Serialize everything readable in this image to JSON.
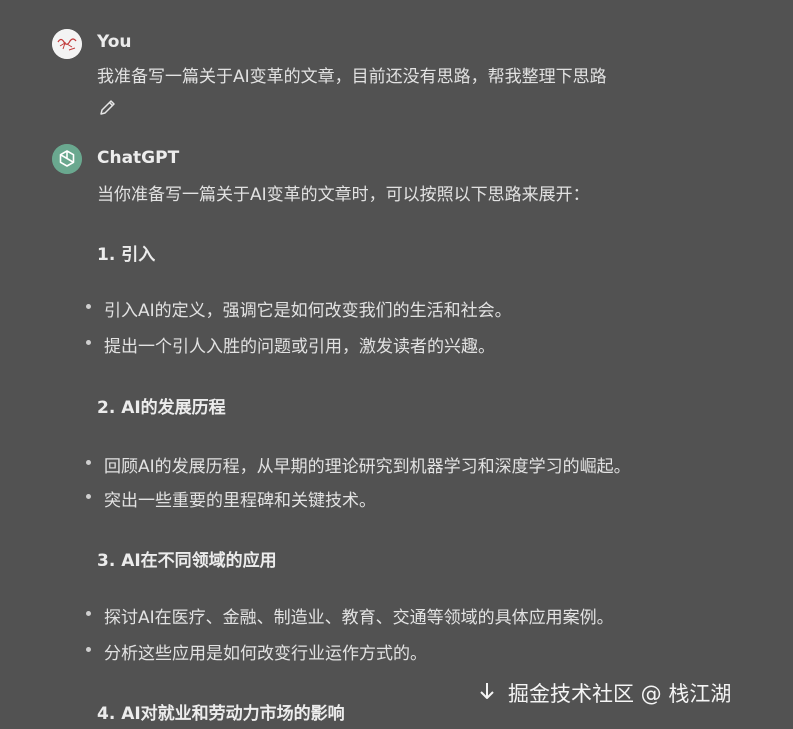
{
  "user_message": {
    "author": "You",
    "text": "我准备写一篇关于AI变革的文章，目前还没有思路，帮我整理下思路",
    "edit_icon": "pencil-icon"
  },
  "assistant_message": {
    "author": "ChatGPT",
    "intro": "当你准备写一篇关于AI变革的文章时，可以按照以下思路来展开：",
    "sections": [
      {
        "heading": "1. 引入",
        "bullets": [
          "引入AI的定义，强调它是如何改变我们的生活和社会。",
          "提出一个引人入胜的问题或引用，激发读者的兴趣。"
        ]
      },
      {
        "heading": "2. AI的发展历程",
        "bullets": [
          "回顾AI的发展历程，从早期的理论研究到机器学习和深度学习的崛起。",
          "突出一些重要的里程碑和关键技术。"
        ]
      },
      {
        "heading": "3. AI在不同领域的应用",
        "bullets": [
          "探讨AI在医疗、金融、制造业、教育、交通等领域的具体应用案例。",
          "分析这些应用是如何改变行业运作方式的。"
        ]
      },
      {
        "heading": "4. AI对就业和劳动力市场的影响",
        "bullets": []
      }
    ]
  },
  "watermark": {
    "text": "掘金技术社区 @ 栈江湖",
    "icon": "down-arrow-icon"
  },
  "colors": {
    "background": "#525252",
    "text": "#e2e2e2",
    "gpt_avatar": "#6aa88f"
  }
}
